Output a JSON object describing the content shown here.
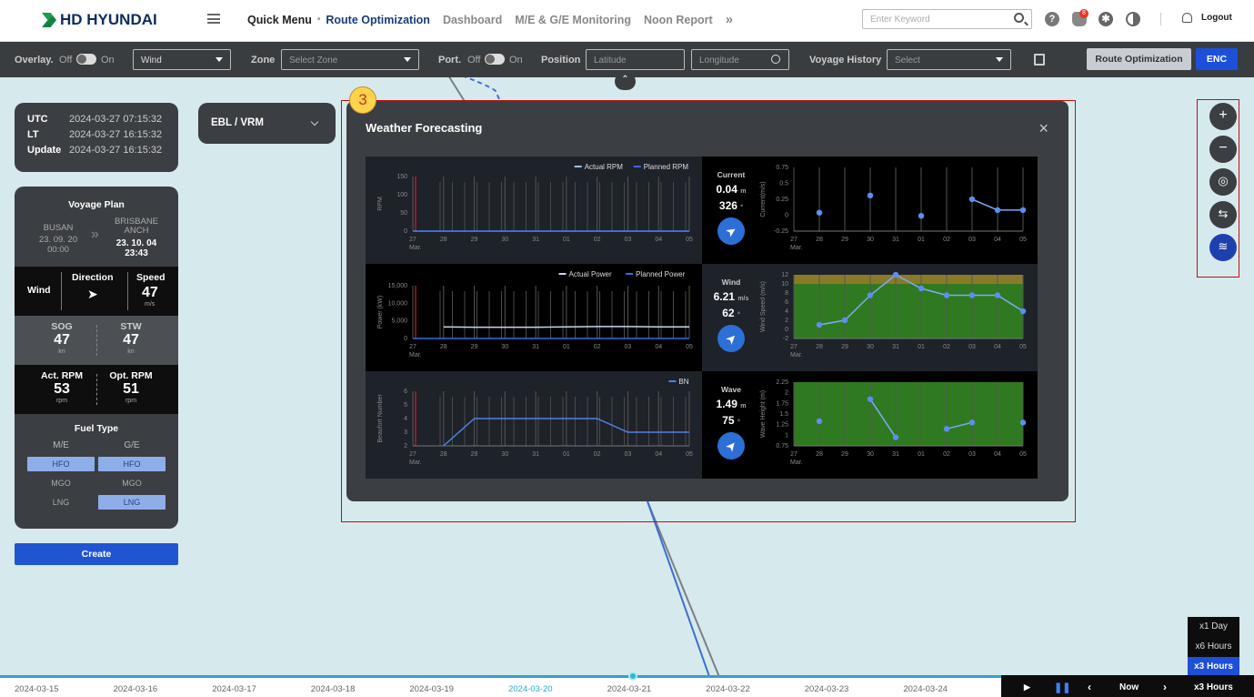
{
  "header": {
    "brand": "HD HYUNDAI",
    "nav": [
      "Quick Menu",
      "Route Optimization",
      "Dashboard",
      "M/E & G/E Monitoring",
      "Noon Report"
    ],
    "search_placeholder": "Enter Keyword",
    "notification_count": "8",
    "logout": "Logout"
  },
  "toolbar": {
    "overlay": "Overlay.",
    "off": "Off",
    "on": "On",
    "overlay_select": "Wind",
    "zone": "Zone",
    "zone_placeholder": "Select Zone",
    "port": "Port.",
    "position": "Position",
    "lat_placeholder": "Latitude",
    "lon_placeholder": "Longitude",
    "voyage_history": "Voyage History",
    "voyage_placeholder": "Select",
    "route_opt_btn": "Route Optimization",
    "enc_btn": "ENC"
  },
  "time": {
    "utc_label": "UTC",
    "utc": "2024-03-27 07:15:32",
    "lt_label": "LT",
    "lt": "2024-03-27 16:15:32",
    "update_label": "Update",
    "update": "2024-03-27 16:15:32"
  },
  "ebl": {
    "label": "EBL / VRM"
  },
  "voyage": {
    "title": "Voyage Plan",
    "from": "BUSAN",
    "from_date": "23. 09. 20",
    "from_time": "00:00",
    "to": "BRISBANE ANCH",
    "to_date": "23. 10. 04",
    "to_time": "23:43",
    "wind_label": "Wind",
    "direction_label": "Direction",
    "speed_label": "Speed",
    "speed": "47",
    "speed_unit": "m/s",
    "sog_label": "SOG",
    "sog": "47",
    "sog_unit": "kn",
    "stw_label": "STW",
    "stw": "47",
    "stw_unit": "kn",
    "act_rpm_label": "Act. RPM",
    "act_rpm": "53",
    "opt_rpm_label": "Opt. RPM",
    "opt_rpm": "51",
    "rpm_unit": "rpm",
    "fuel_title": "Fuel Type",
    "me": "M/E",
    "ge": "G/E",
    "hfo": "HFO",
    "mgo": "MGO",
    "lng": "LNG"
  },
  "create": "Create",
  "modal": {
    "marker": "3",
    "title": "Weather Forecasting",
    "close": "×",
    "current_label": "Current",
    "current_value": "0.04",
    "current_unit": "m",
    "current_dir": "326",
    "current_deg": "°",
    "wind_label": "Wind",
    "wind_value": "6.21",
    "wind_unit": "m/s",
    "wind_dir": "62",
    "wind_deg": "°",
    "wave_label": "Wave",
    "wave_value": "1.49",
    "wave_unit": "m",
    "wave_dir": "75",
    "wave_deg": "°"
  },
  "chart_data": [
    {
      "type": "line",
      "ylabel": "RPM",
      "yticks": [
        "150",
        "100",
        "50",
        "0"
      ],
      "ylim": [
        0,
        150
      ],
      "x": [
        "27",
        "28",
        "29",
        "30",
        "31",
        "01",
        "02",
        "03",
        "04",
        "05"
      ],
      "xlabel": "Mar.",
      "legend": "top-right",
      "series": [
        {
          "name": "Actual RPM",
          "values": [
            0,
            0,
            0,
            0,
            0,
            0,
            0,
            0,
            0,
            0
          ]
        },
        {
          "name": "Planned RPM",
          "values": [
            0,
            0,
            0,
            0,
            0,
            0,
            0,
            0,
            0,
            0
          ]
        }
      ]
    },
    {
      "type": "line",
      "ylabel": "Power (kW)",
      "yticks": [
        "15,000",
        "10,000",
        "5,000",
        "0"
      ],
      "ylim": [
        0,
        15000
      ],
      "x": [
        "27",
        "28",
        "29",
        "30",
        "31",
        "01",
        "02",
        "03",
        "04",
        "05"
      ],
      "xlabel": "Mar.",
      "legend": "top-right",
      "series": [
        {
          "name": "Actual Power",
          "values": [
            null,
            3300,
            3200,
            3200,
            3200,
            3300,
            3400,
            3400,
            3300,
            3300
          ]
        },
        {
          "name": "Planned Power",
          "values": [
            0,
            0,
            0,
            0,
            0,
            0,
            0,
            0,
            0,
            0
          ]
        }
      ]
    },
    {
      "type": "line",
      "ylabel": "Beaufort Number",
      "yticks": [
        "6",
        "5",
        "4",
        "3",
        "2"
      ],
      "ylim": [
        2,
        6
      ],
      "x": [
        "27",
        "28",
        "29",
        "30",
        "31",
        "01",
        "02",
        "03",
        "04",
        "05"
      ],
      "xlabel": "Mar.",
      "legend": "top-right",
      "series": [
        {
          "name": "BN",
          "values": [
            null,
            2,
            4,
            4,
            4,
            4,
            4,
            3,
            3,
            3
          ]
        }
      ]
    },
    {
      "type": "line",
      "ylabel": "Current(m/s)",
      "yticks": [
        "0.75",
        "0.5",
        "0.25",
        "0",
        "-0.25"
      ],
      "ylim": [
        -0.25,
        0.75
      ],
      "x": [
        "27",
        "28",
        "29",
        "30",
        "31",
        "01",
        "02",
        "03",
        "04",
        "05"
      ],
      "xlabel": "Mar.",
      "series": [
        {
          "values": [
            null,
            0.04,
            null,
            0.31,
            null,
            -0.01,
            null,
            0.25,
            0.08,
            0.08
          ]
        }
      ]
    },
    {
      "type": "line",
      "ylabel": "Wind Speed (m/s)",
      "yticks": [
        "12",
        "10",
        "8",
        "6",
        "4",
        "2",
        "0",
        "-2"
      ],
      "ylim": [
        -2,
        12
      ],
      "x": [
        "27",
        "28",
        "29",
        "30",
        "31",
        "01",
        "02",
        "03",
        "04",
        "05"
      ],
      "xlabel": "Mar.",
      "series": [
        {
          "values": [
            null,
            1,
            2,
            7.5,
            12,
            9,
            7.5,
            7.5,
            7.5,
            4
          ]
        }
      ]
    },
    {
      "type": "line",
      "ylabel": "Wave Height (m)",
      "yticks": [
        "2.25",
        "2",
        "1.75",
        "1.5",
        "1.25",
        "1",
        "0.75"
      ],
      "ylim": [
        0.75,
        2.25
      ],
      "x": [
        "27",
        "28",
        "29",
        "30",
        "31",
        "01",
        "02",
        "03",
        "04",
        "05"
      ],
      "xlabel": "Mar.",
      "series": [
        {
          "values": [
            null,
            1.33,
            null,
            1.85,
            0.95,
            null,
            1.15,
            1.3,
            null,
            1.3
          ]
        }
      ]
    }
  ],
  "speed_options": [
    "x1 Day",
    "x6 Hours",
    "x3 Hours"
  ],
  "timeline": {
    "dates": [
      "2024-03-15",
      "2024-03-16",
      "2024-03-17",
      "2024-03-18",
      "2024-03-19",
      "2024-03-20",
      "2024-03-21",
      "2024-03-22",
      "2024-03-23",
      "2024-03-24"
    ],
    "now": "Now",
    "speed": "x3 Hours"
  }
}
